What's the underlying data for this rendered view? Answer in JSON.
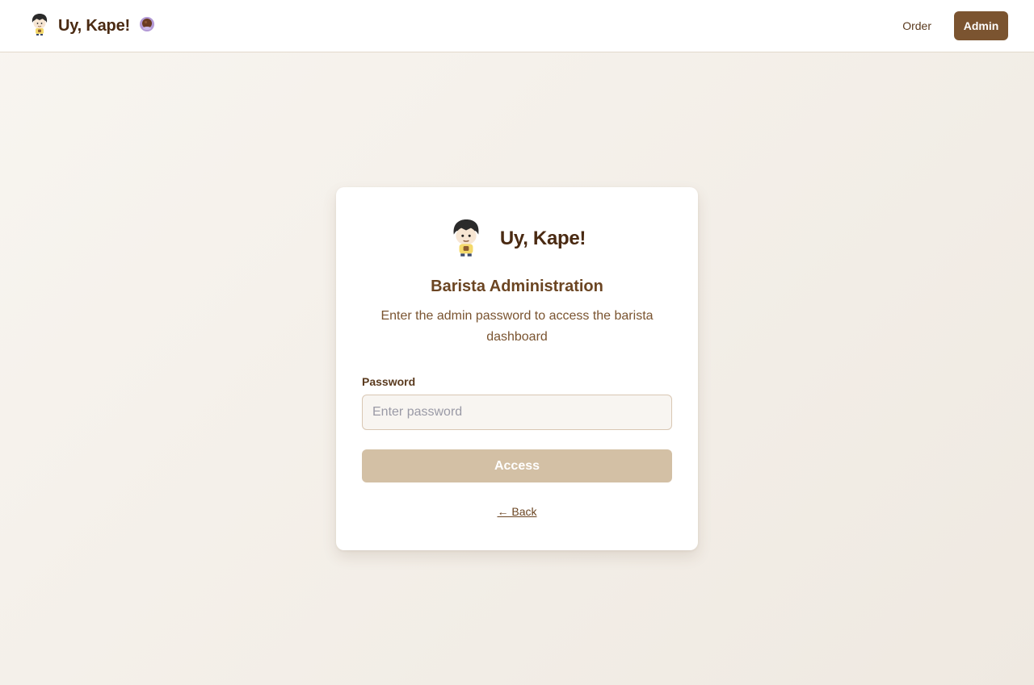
{
  "navbar": {
    "brand_title": "Uy, Kape!",
    "order_label": "Order",
    "admin_label": "Admin"
  },
  "card": {
    "brand_title": "Uy, Kape!",
    "heading": "Barista Administration",
    "subtitle": "Enter the admin password to access the barista dashboard",
    "password_label": "Password",
    "password_placeholder": "Enter password",
    "password_value": "",
    "access_label": "Access",
    "back_label": "← Back"
  },
  "icons": {
    "logo": "barista-mascot-icon",
    "cup": "coffee-cup-icon"
  },
  "colors": {
    "accent": "#7b5430",
    "button_disabled": "#d3c0a5",
    "text_dark": "#4a2a12"
  }
}
